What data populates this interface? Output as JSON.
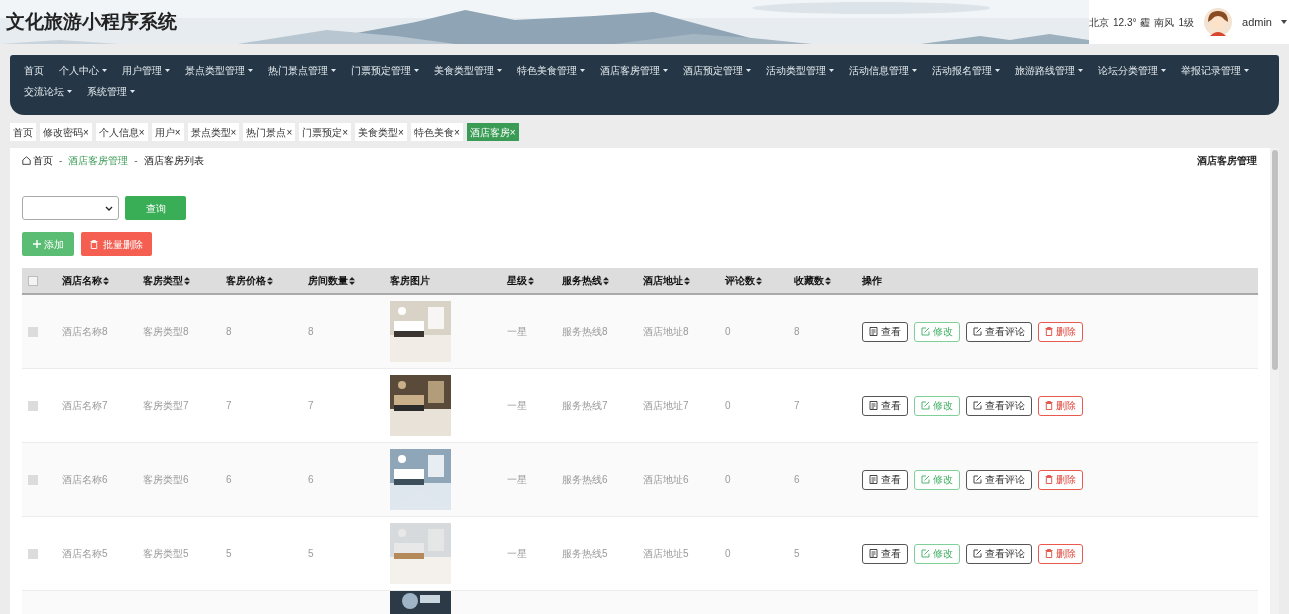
{
  "header": {
    "title": "文化旅游小程序系统",
    "weather": {
      "city": "北京",
      "temperature": "12.3°",
      "condition": "霾",
      "wind": "南风",
      "wind_level": "1级"
    },
    "user": {
      "name": "admin"
    }
  },
  "nav": [
    {
      "label": "首页",
      "dropdown": false
    },
    {
      "label": "个人中心",
      "dropdown": true
    },
    {
      "label": "用户管理",
      "dropdown": true
    },
    {
      "label": "景点类型管理",
      "dropdown": true
    },
    {
      "label": "热门景点管理",
      "dropdown": true
    },
    {
      "label": "门票预定管理",
      "dropdown": true
    },
    {
      "label": "美食类型管理",
      "dropdown": true
    },
    {
      "label": "特色美食管理",
      "dropdown": true
    },
    {
      "label": "酒店客房管理",
      "dropdown": true
    },
    {
      "label": "酒店预定管理",
      "dropdown": true
    },
    {
      "label": "活动类型管理",
      "dropdown": true
    },
    {
      "label": "活动信息管理",
      "dropdown": true
    },
    {
      "label": "活动报名管理",
      "dropdown": true
    },
    {
      "label": "旅游路线管理",
      "dropdown": true
    },
    {
      "label": "论坛分类管理",
      "dropdown": true
    },
    {
      "label": "举报记录管理",
      "dropdown": true
    },
    {
      "label": "交流论坛",
      "dropdown": true
    },
    {
      "label": "系统管理",
      "dropdown": true
    }
  ],
  "tags": [
    {
      "label": "首页",
      "selected": false
    },
    {
      "label": "修改密码",
      "close": "×",
      "selected": false
    },
    {
      "label": "个人信息",
      "close": "×",
      "selected": false
    },
    {
      "label": "用户",
      "close": "×",
      "selected": false
    },
    {
      "label": "景点类型",
      "close": "×",
      "selected": false
    },
    {
      "label": "热门景点",
      "close": "×",
      "selected": false
    },
    {
      "label": "门票预定",
      "close": "×",
      "selected": false
    },
    {
      "label": "美食类型",
      "close": "×",
      "selected": false
    },
    {
      "label": "特色美食",
      "close": "×",
      "selected": false
    },
    {
      "label": "酒店客房",
      "close": "×",
      "selected": true
    }
  ],
  "breadcrumb": {
    "items": [
      {
        "label": "首页"
      },
      {
        "separator": "-",
        "label": "酒店客房管理"
      },
      {
        "separator": "-",
        "label": "酒店客房列表"
      }
    ],
    "page_title": "酒店客房管理"
  },
  "toolbar": {
    "search_button": "查询",
    "add_button": "添加",
    "batch_delete_button": "批量删除"
  },
  "table": {
    "select_all_checked": false,
    "columns": [
      {
        "label": "酒店名称",
        "sortable": true
      },
      {
        "label": "客房类型",
        "sortable": true
      },
      {
        "label": "客房价格",
        "sortable": true
      },
      {
        "label": "房间数量",
        "sortable": true
      },
      {
        "label": "客房图片",
        "sortable": false
      },
      {
        "label": "星级",
        "sortable": true
      },
      {
        "label": "服务热线",
        "sortable": true
      },
      {
        "label": "酒店地址",
        "sortable": true
      },
      {
        "label": "评论数",
        "sortable": true
      },
      {
        "label": "收藏数",
        "sortable": true
      },
      {
        "label": "操作",
        "sortable": false
      }
    ],
    "rows": [
      {
        "checked": false,
        "cells": [
          "酒店名称8",
          "客房类型8",
          "8",
          "8",
          {
            "kind": "picture"
          },
          "一星",
          "服务热线8",
          "酒店地址8",
          "0",
          "8"
        ],
        "actions": [
          {
            "kind": "view",
            "label": "查看"
          },
          {
            "kind": "edit",
            "label": "修改"
          },
          {
            "kind": "comments",
            "label": "查看评论"
          },
          {
            "kind": "delete",
            "label": "删除"
          }
        ]
      },
      {
        "checked": false,
        "cells": [
          "酒店名称7",
          "客房类型7",
          "7",
          "7",
          {
            "kind": "picture"
          },
          "一星",
          "服务热线7",
          "酒店地址7",
          "0",
          "7"
        ],
        "actions": [
          {
            "kind": "view",
            "label": "查看"
          },
          {
            "kind": "edit",
            "label": "修改"
          },
          {
            "kind": "comments",
            "label": "查看评论"
          },
          {
            "kind": "delete",
            "label": "删除"
          }
        ]
      },
      {
        "checked": false,
        "cells": [
          "酒店名称6",
          "客房类型6",
          "6",
          "6",
          {
            "kind": "picture"
          },
          "一星",
          "服务热线6",
          "酒店地址6",
          "0",
          "6"
        ],
        "actions": [
          {
            "kind": "view",
            "label": "查看"
          },
          {
            "kind": "edit",
            "label": "修改"
          },
          {
            "kind": "comments",
            "label": "查看评论"
          },
          {
            "kind": "delete",
            "label": "删除"
          }
        ]
      },
      {
        "checked": false,
        "cells": [
          "酒店名称5",
          "客房类型5",
          "5",
          "5",
          {
            "kind": "picture"
          },
          "一星",
          "服务热线5",
          "酒店地址5",
          "0",
          "5"
        ],
        "actions": [
          {
            "kind": "view",
            "label": "查看"
          },
          {
            "kind": "edit",
            "label": "修改"
          },
          {
            "kind": "comments",
            "label": "查看评论"
          },
          {
            "kind": "delete",
            "label": "删除"
          }
        ]
      }
    ]
  }
}
